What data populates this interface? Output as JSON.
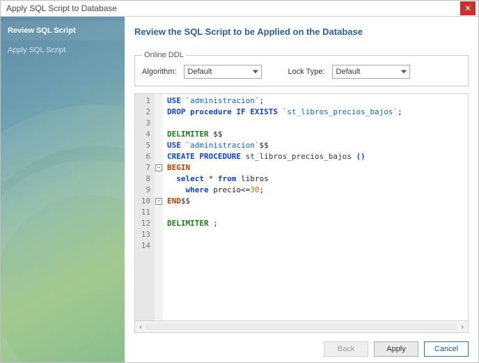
{
  "window": {
    "title": "Apply SQL Script to Database"
  },
  "sidebar": {
    "items": [
      {
        "label": "Review SQL Script",
        "active": true
      },
      {
        "label": "Apply SQL Script",
        "active": false
      }
    ]
  },
  "main": {
    "heading": "Review the SQL Script to be Applied on the Database",
    "ddl": {
      "legend": "Online DDL",
      "algorithm_label": "Algorithm:",
      "algorithm_value": "Default",
      "locktype_label": "Lock Type:",
      "locktype_value": "Default"
    },
    "code": {
      "line_count": 14,
      "lines": [
        {
          "n": 1,
          "html": "<span class='kw2'>USE</span> <span class='str'>`administracion`</span>;"
        },
        {
          "n": 2,
          "html": "<span class='kw2'>DROP procedure IF EXISTS</span> <span class='str'>`st_libros_precios_bajos`</span>;"
        },
        {
          "n": 3,
          "html": ""
        },
        {
          "n": 4,
          "html": "<span class='kw'>DELIMITER</span> $$"
        },
        {
          "n": 5,
          "html": "<span class='kw2'>USE</span> <span class='str'>`administracion`</span>$$"
        },
        {
          "n": 6,
          "html": "<span class='kw2'>CREATE PROCEDURE</span> <span class='id'>st_libros_precios_bajos</span> <span class='kw2'>()</span>"
        },
        {
          "n": 7,
          "html": "<span class='begin'>BEGIN</span>",
          "fold": "-"
        },
        {
          "n": 8,
          "html": "  <span class='kw2'>select</span> * <span class='kw2'>from</span> libros"
        },
        {
          "n": 9,
          "html": "    <span class='kw2'>where</span> precio&lt;=<span class='num'>30</span>;"
        },
        {
          "n": 10,
          "html": "<span class='begin'>END</span>$$",
          "fold": "-"
        },
        {
          "n": 11,
          "html": ""
        },
        {
          "n": 12,
          "html": "<span class='kw'>DELIMITER</span> ;"
        },
        {
          "n": 13,
          "html": ""
        },
        {
          "n": 14,
          "html": ""
        }
      ]
    }
  },
  "buttons": {
    "back": "Back",
    "apply": "Apply",
    "cancel": "Cancel"
  },
  "icons": {
    "close": "✕",
    "left": "‹",
    "right": "›"
  }
}
